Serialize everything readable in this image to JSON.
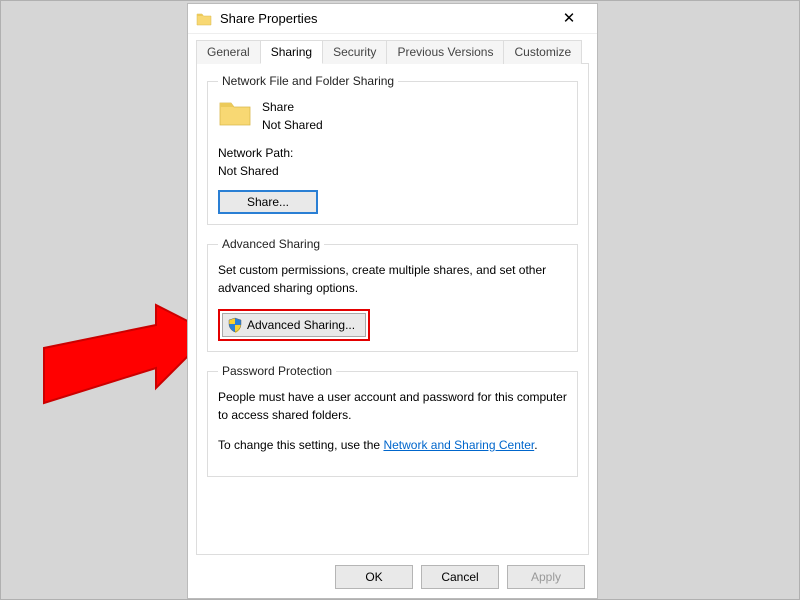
{
  "window": {
    "title": "Share Properties"
  },
  "tabs": [
    {
      "label": "General"
    },
    {
      "label": "Sharing"
    },
    {
      "label": "Security"
    },
    {
      "label": "Previous Versions"
    },
    {
      "label": "Customize"
    }
  ],
  "network_file_sharing": {
    "legend": "Network File and Folder Sharing",
    "folder_name": "Share",
    "share_status": "Not Shared",
    "network_path_label": "Network Path:",
    "network_path_value": "Not Shared",
    "share_button": "Share..."
  },
  "advanced_sharing": {
    "legend": "Advanced Sharing",
    "description": "Set custom permissions, create multiple shares, and set other advanced sharing options.",
    "button_label": "Advanced Sharing..."
  },
  "password_protection": {
    "legend": "Password Protection",
    "line1": "People must have a user account and password for this computer to access shared folders.",
    "line2_prefix": "To change this setting, use the ",
    "link_label": "Network and Sharing Center",
    "line2_suffix": "."
  },
  "footer": {
    "ok": "OK",
    "cancel": "Cancel",
    "apply": "Apply"
  }
}
